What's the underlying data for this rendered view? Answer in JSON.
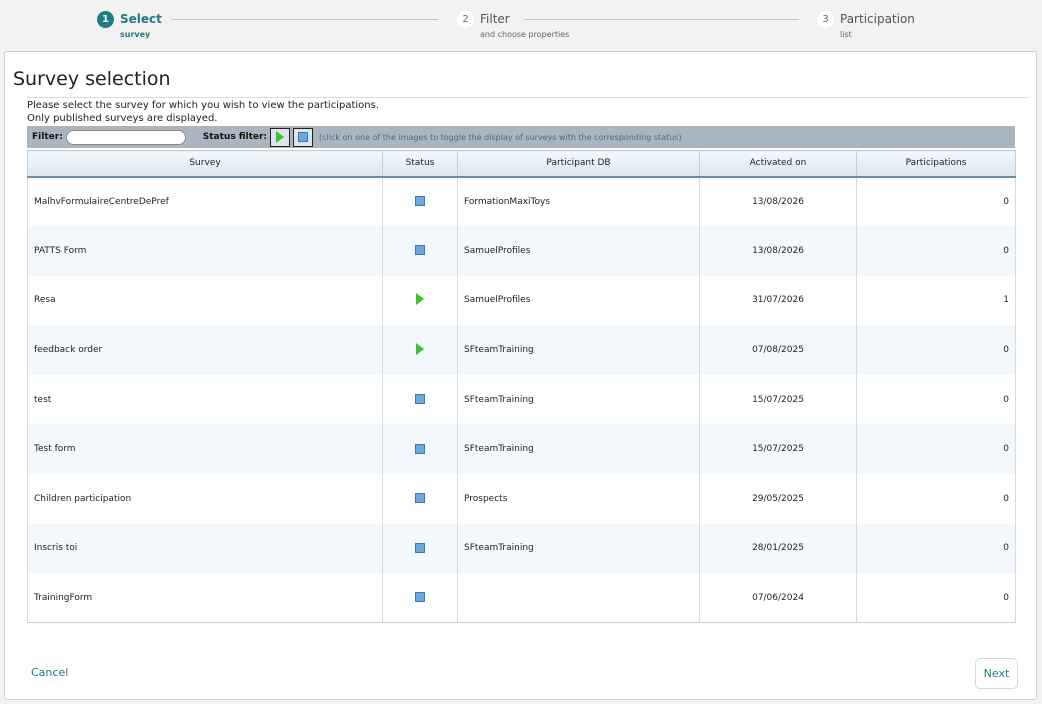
{
  "wizard": {
    "steps": [
      {
        "num": "1",
        "title": "Select",
        "subtitle": "survey"
      },
      {
        "num": "2",
        "title": "Filter",
        "subtitle": "and choose properties"
      },
      {
        "num": "3",
        "title": "Participation",
        "subtitle": "list"
      }
    ],
    "active_step": 1
  },
  "page": {
    "title": "Survey selection",
    "intro_line1": "Please select the survey for which you wish to view the participations.",
    "intro_line2": "Only published surveys are displayed."
  },
  "filterbar": {
    "filter_label": "Filter:",
    "filter_value": "",
    "status_label": "Status filter:",
    "hint": "(click on one of the images to toggle the display of surveys with the corresponding status)"
  },
  "table": {
    "columns": [
      "Survey",
      "Status",
      "Participant DB",
      "Activated on",
      "Participations"
    ],
    "rows": [
      {
        "survey": "MalhvFormulaireCentreDePref",
        "status": "stopped",
        "db": "FormationMaxiToys",
        "activated": "13/08/2026",
        "participations": "0"
      },
      {
        "survey": "PATTS Form",
        "status": "stopped",
        "db": "SamuelProfiles",
        "activated": "13/08/2026",
        "participations": "0"
      },
      {
        "survey": "Resa",
        "status": "running",
        "db": "SamuelProfiles",
        "activated": "31/07/2026",
        "participations": "1"
      },
      {
        "survey": "feedback order",
        "status": "running",
        "db": "SFteamTraining",
        "activated": "07/08/2025",
        "participations": "0"
      },
      {
        "survey": "test",
        "status": "stopped",
        "db": "SFteamTraining",
        "activated": "15/07/2025",
        "participations": "0"
      },
      {
        "survey": "Test form",
        "status": "stopped",
        "db": "SFteamTraining",
        "activated": "15/07/2025",
        "participations": "0"
      },
      {
        "survey": "Children participation",
        "status": "stopped",
        "db": "Prospects",
        "activated": "29/05/2025",
        "participations": "0"
      },
      {
        "survey": "Inscris toi",
        "status": "stopped",
        "db": "SFteamTraining",
        "activated": "28/01/2025",
        "participations": "0"
      },
      {
        "survey": "TrainingForm",
        "status": "stopped",
        "db": "",
        "activated": "07/06/2024",
        "participations": "0"
      }
    ]
  },
  "footer": {
    "cancel_label": "Cancel",
    "next_label": "Next"
  },
  "colors": {
    "accent": "#1e7d82",
    "running_icon": "#3fbf2f",
    "stopped_icon": "#6ea7e0"
  }
}
